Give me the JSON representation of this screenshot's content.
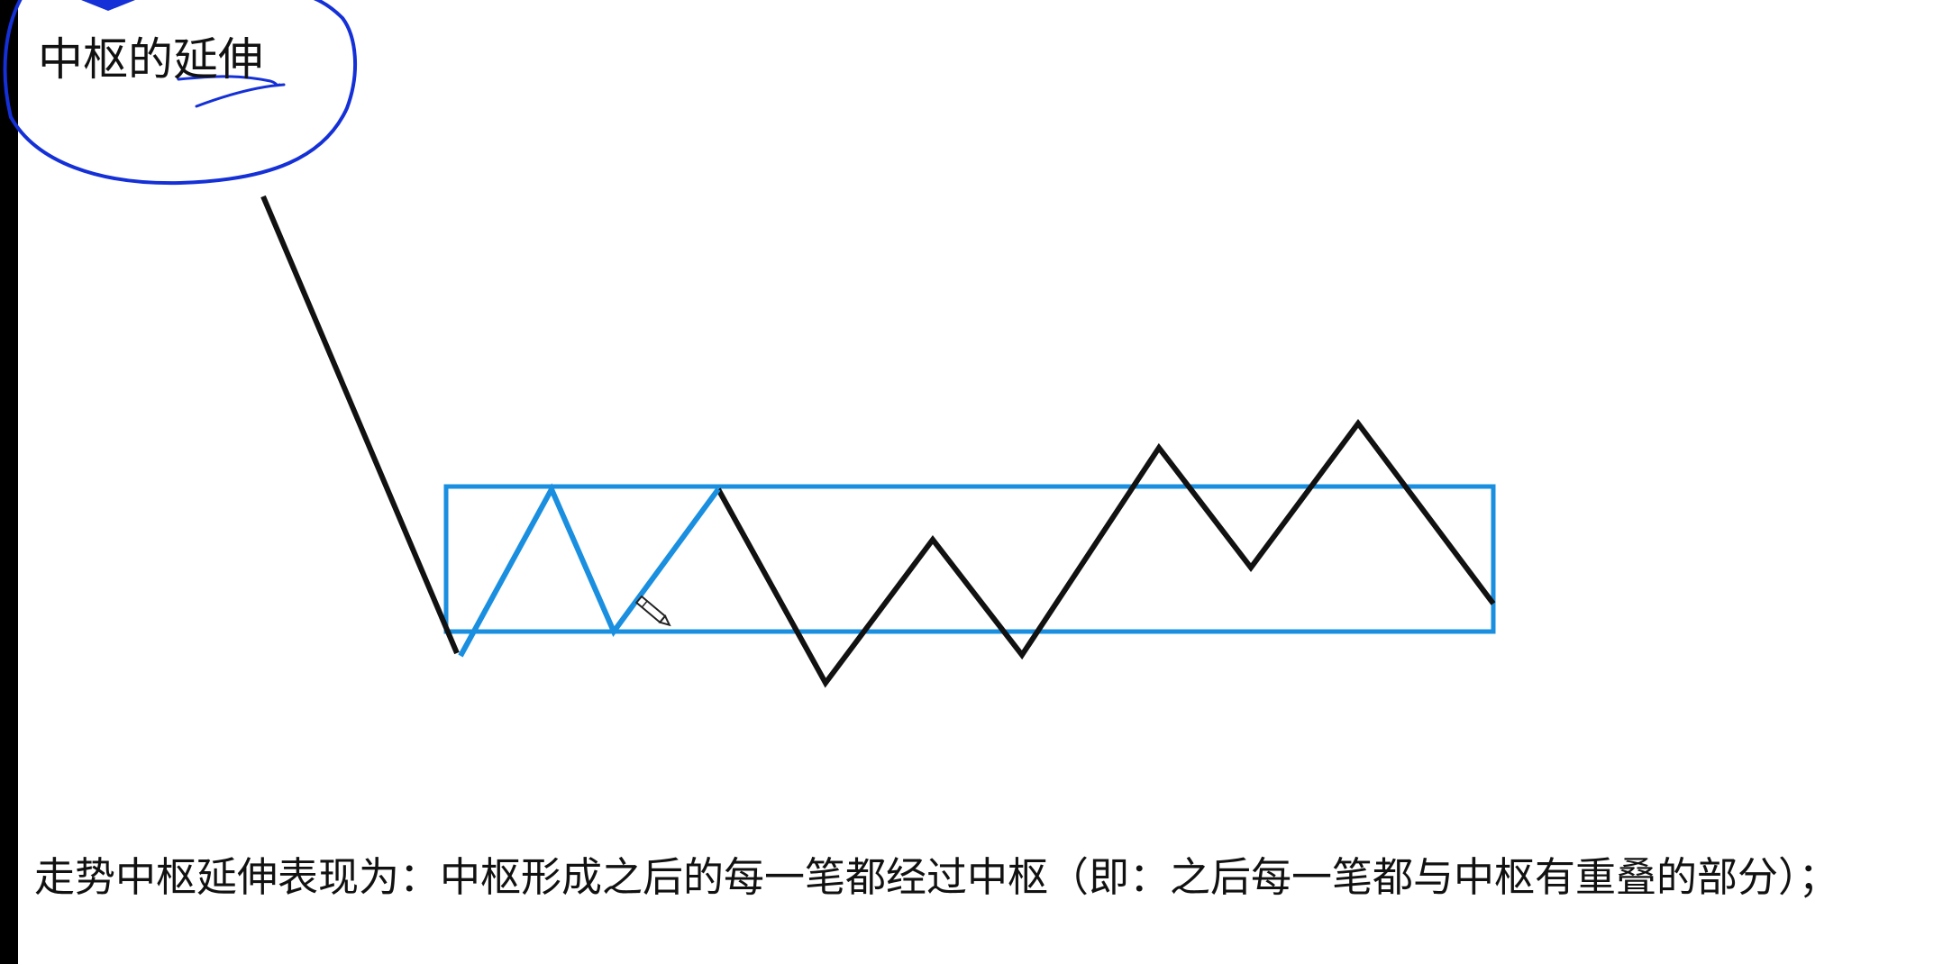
{
  "title": "中枢的延伸",
  "caption": "走势中枢延伸表现为：中枢形成之后的每一笔都经过中枢（即：之后每一笔都与中枢有重叠的部分）；",
  "colors": {
    "background": "#ffffff",
    "left_bar": "#000000",
    "price_line": "#111111",
    "zhongshu": "#1a8fe0",
    "annotation_ink": "#1430d6"
  },
  "icons": {
    "cursor": "pencil-cursor-icon"
  }
}
